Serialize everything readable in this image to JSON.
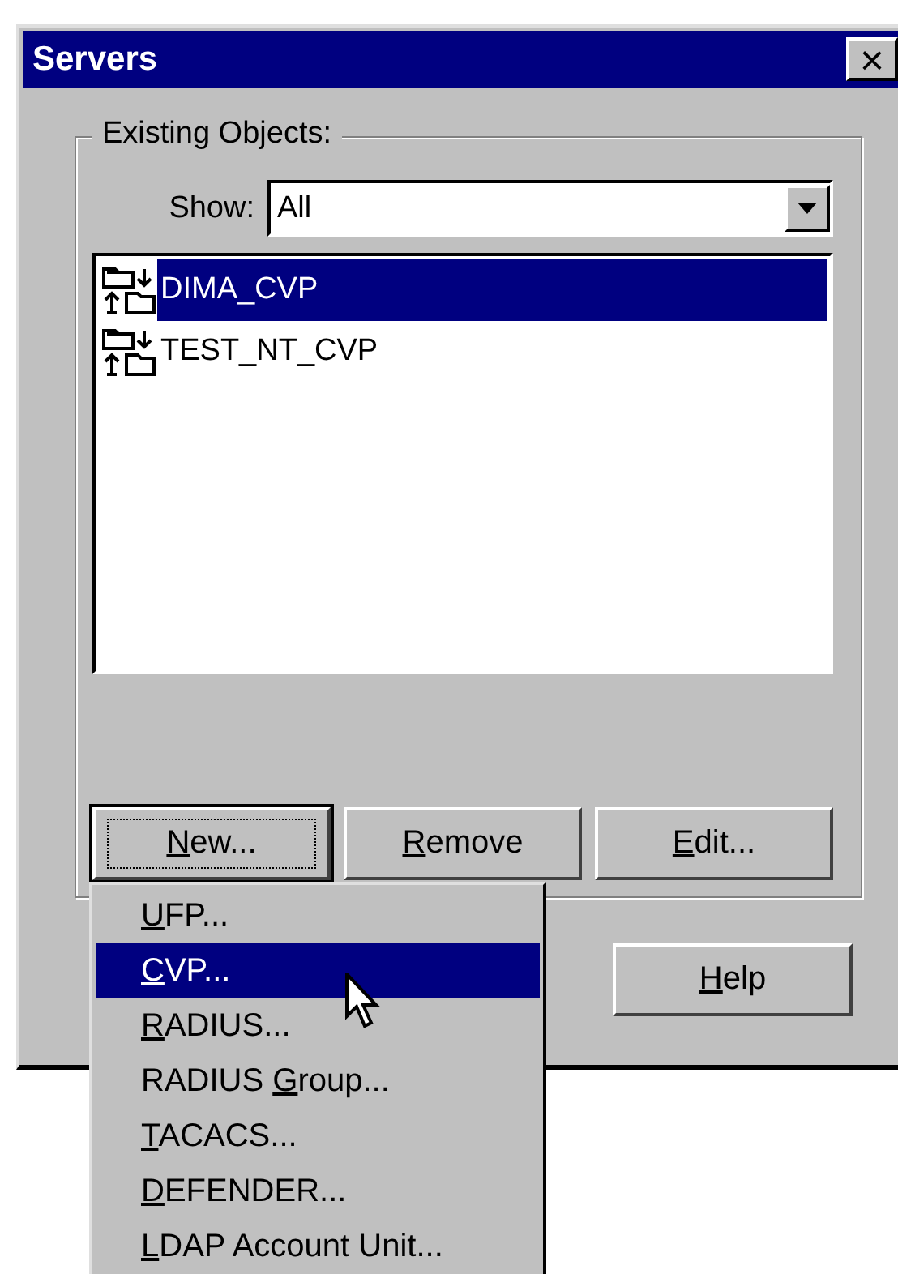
{
  "window": {
    "title": "Servers",
    "close": "×"
  },
  "group": {
    "title": "Existing Objects:"
  },
  "show": {
    "label": "Show:",
    "value": "All"
  },
  "objects": [
    {
      "name": "DIMA_CVP",
      "selected": true
    },
    {
      "name": "TEST_NT_CVP",
      "selected": false
    }
  ],
  "buttons": [
    {
      "key": "N",
      "after": "ew...",
      "focused": true
    },
    {
      "key": "R",
      "after": "emove",
      "focused": false
    },
    {
      "key": "E",
      "after": "dit...",
      "focused": false
    }
  ],
  "help_button": {
    "key": "H",
    "after": "elp"
  },
  "menu": [
    {
      "key": "U",
      "after": "FP...",
      "selected": false
    },
    {
      "key": "C",
      "after": "VP...",
      "selected": true
    },
    {
      "key": "R",
      "after": "ADIUS...",
      "selected": false
    },
    {
      "before": "RADIUS ",
      "key": "G",
      "after": "roup...",
      "selected": false
    },
    {
      "key": "T",
      "after": "ACACS...",
      "selected": false
    },
    {
      "key": "D",
      "after": "EFENDER...",
      "selected": false
    },
    {
      "key": "L",
      "after": "DAP Account Unit...",
      "selected": false
    }
  ]
}
